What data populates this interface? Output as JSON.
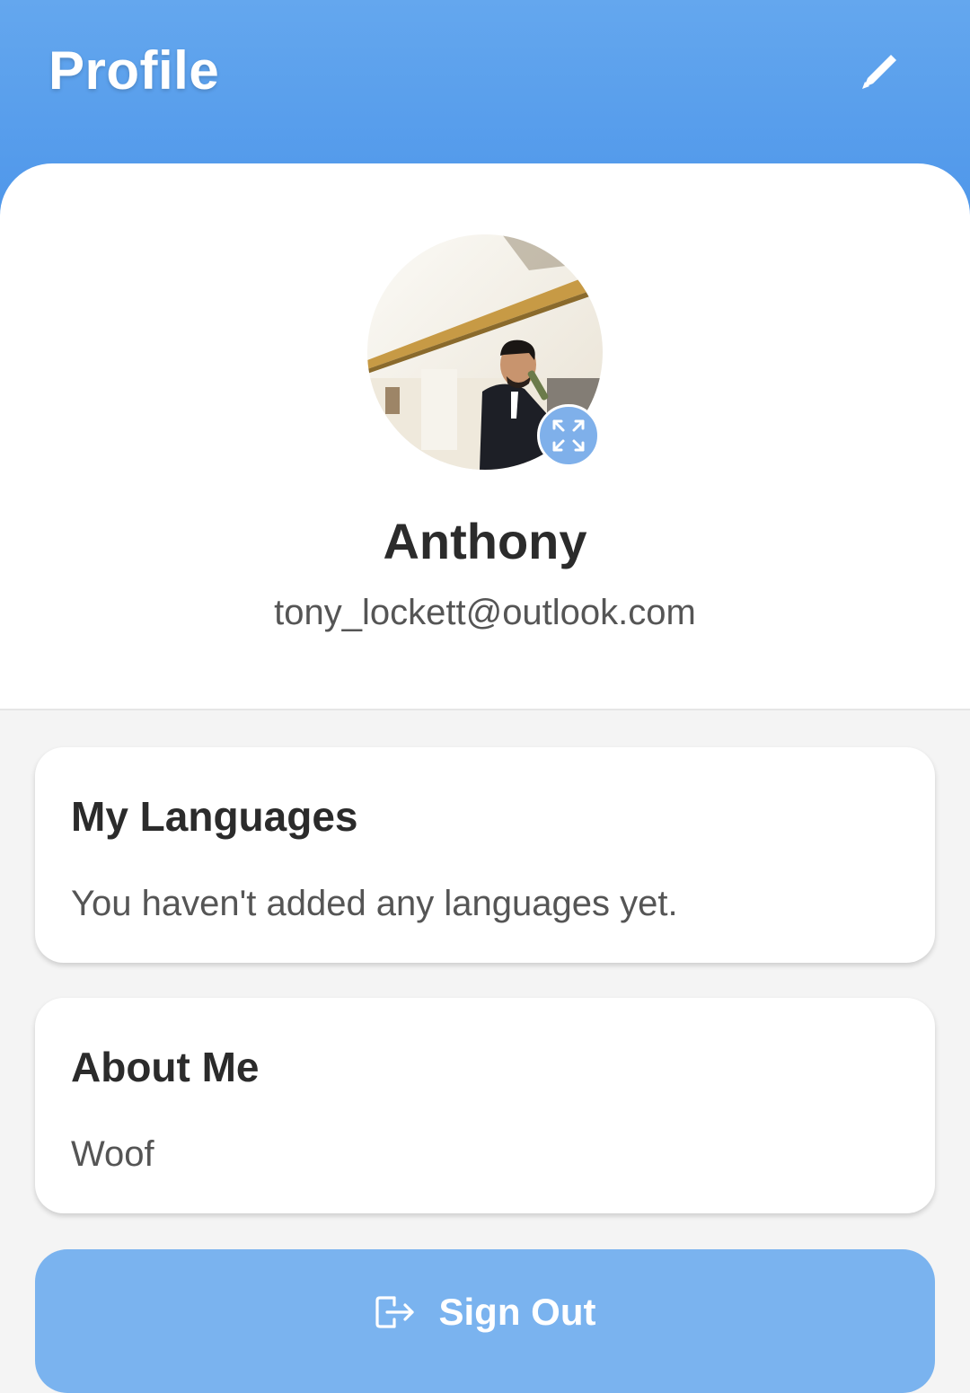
{
  "header": {
    "title": "Profile",
    "edit_icon": "pencil-icon"
  },
  "profile": {
    "name": "Anthony",
    "email": "tony_lockett@outlook.com",
    "avatar_icon": "avatar-photo",
    "expand_icon": "expand-icon"
  },
  "languages_card": {
    "title": "My Languages",
    "empty_text": "You haven't added any languages yet."
  },
  "about_card": {
    "title": "About Me",
    "text": "Woof"
  },
  "sign_out": {
    "label": "Sign Out",
    "icon": "sign-out-icon"
  },
  "colors": {
    "header_top": "#64a7ee",
    "header_bottom": "#4f97ea",
    "button": "#7ab3ef",
    "background": "#f4f4f4",
    "text_dark": "#2b2b2b",
    "text_muted": "#555555"
  }
}
